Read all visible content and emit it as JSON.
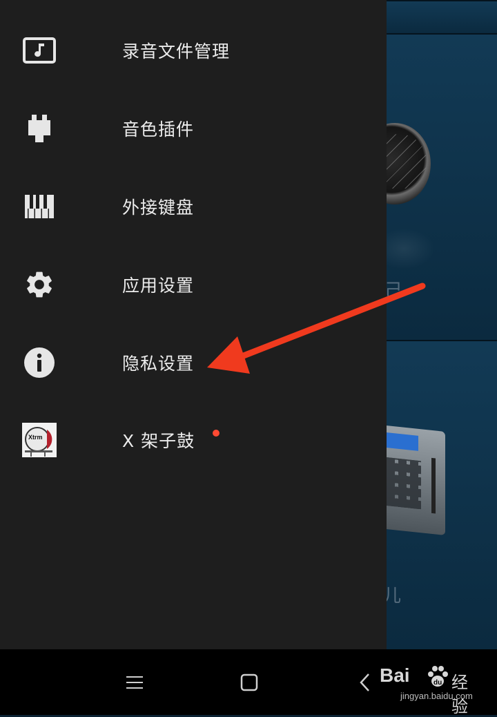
{
  "menu": {
    "items": [
      {
        "id": "recordings",
        "label": "录音文件管理",
        "icon": "music-note-icon"
      },
      {
        "id": "plugins",
        "label": "音色插件",
        "icon": "plug-icon"
      },
      {
        "id": "keyboard",
        "label": "外接键盘",
        "icon": "piano-keys-icon"
      },
      {
        "id": "settings",
        "label": "应用设置",
        "icon": "gear-icon"
      },
      {
        "id": "privacy",
        "label": "隐私设置",
        "icon": "info-icon"
      },
      {
        "id": "xdrum",
        "label": "X 架子鼓",
        "icon": "x-drum-app-icon",
        "badge": "new-dot"
      }
    ]
  },
  "annotation": {
    "color": "#f03a1e"
  },
  "navbar": {
    "buttons": [
      "menu-icon",
      "home-square-icon",
      "back-chevron-icon"
    ]
  },
  "watermark": {
    "brand": "Bai",
    "suffix": "经验",
    "url": "jingyan.baidu.com"
  },
  "background": {
    "visible_chars": [
      "己",
      "儿"
    ]
  }
}
